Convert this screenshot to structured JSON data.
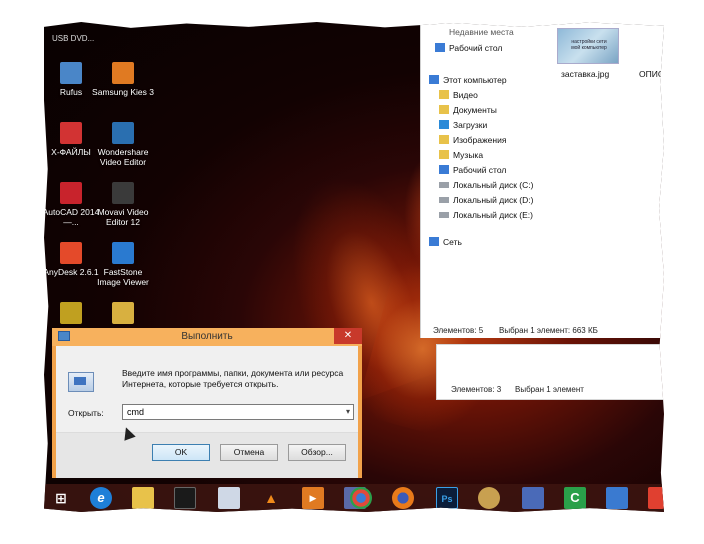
{
  "desktop": {
    "top_label": "USB DVD...",
    "icons": [
      {
        "label": "Rufus",
        "color": "#4a86c8"
      },
      {
        "label": "Samsung Kies 3",
        "color": "#e07a22"
      },
      {
        "label": "X-ФАЙЛЫ",
        "color": "#d23333"
      },
      {
        "label": "Wondershare Video Editor",
        "color": "#2a6fb0"
      },
      {
        "label": "AutoCAD 2014 —...",
        "color": "#c8232c"
      },
      {
        "label": "Movavi Video Editor 12",
        "color": "#3a3a3a"
      },
      {
        "label": "AnyDesk 2.6.1",
        "color": "#e44a2a"
      },
      {
        "label": "FastStone Image Viewer",
        "color": "#2a7ad0"
      },
      {
        "label": "",
        "color": "#c0a020"
      },
      {
        "label": "",
        "color": "#d8b040"
      }
    ]
  },
  "explorer": {
    "partial_top": "Недавние места",
    "thumbnail_caption_line1": "настройки сети",
    "thumbnail_caption_line2": "мой компьютер",
    "nav": [
      {
        "label": "Рабочий стол",
        "icon": "desktop-folder-icon",
        "color": "#3a7bd5"
      },
      {
        "label": "Этот компьютер",
        "icon": "computer-icon",
        "color": "#3a7bd5"
      },
      {
        "label": "Видео",
        "icon": "video-folder-icon",
        "color": "#e8c24a"
      },
      {
        "label": "Документы",
        "icon": "documents-folder-icon",
        "color": "#e8c24a"
      },
      {
        "label": "Загрузки",
        "icon": "downloads-folder-icon",
        "color": "#2a8ad8"
      },
      {
        "label": "Изображения",
        "icon": "pictures-folder-icon",
        "color": "#e8c24a"
      },
      {
        "label": "Музыка",
        "icon": "music-folder-icon",
        "color": "#e8c24a"
      },
      {
        "label": "Рабочий стол",
        "icon": "desktop-folder-icon",
        "color": "#3a7bd5"
      },
      {
        "label": "Локальный диск (C:)",
        "icon": "drive-icon",
        "color": "#9aa0a8"
      },
      {
        "label": "Локальный диск (D:)",
        "icon": "drive-icon",
        "color": "#9aa0a8"
      },
      {
        "label": "Локальный диск (E:)",
        "icon": "drive-icon",
        "color": "#9aa0a8"
      },
      {
        "label": "Сеть",
        "icon": "network-icon",
        "color": "#3a7bd5"
      }
    ],
    "file1": "заставка.jpg",
    "file2": "ОПИСА",
    "status_count": "Элементов: 5",
    "status_selected": "Выбран 1 элемент: 663 КБ"
  },
  "explorer2": {
    "status_count": "Элементов: 3",
    "status_selected": "Выбран 1 элемент"
  },
  "run_dialog": {
    "title": "Выполнить",
    "close": "✕",
    "description": "Введите имя программы, папки, документа или ресурса Интернета, которые требуется открыть.",
    "open_label": "Открыть:",
    "input_value": "cmd",
    "ok": "OK",
    "cancel": "Отмена",
    "browse": "Обзор..."
  },
  "taskbar": {
    "items": [
      {
        "name": "start-button",
        "glyph": "⊞",
        "color": "transparent"
      },
      {
        "name": "internet-explorer-icon",
        "glyph": "e",
        "color": "#1e7fd8"
      },
      {
        "name": "file-explorer-icon",
        "glyph": "",
        "color": "#e8c24a"
      },
      {
        "name": "cmd-icon",
        "glyph": "",
        "color": "#1a1a1a"
      },
      {
        "name": "notepad-icon",
        "glyph": "",
        "color": "#cfd8e6"
      },
      {
        "name": "vlc-icon",
        "glyph": "▲",
        "color": "transparent"
      },
      {
        "name": "media-player-icon",
        "glyph": "▶",
        "color": "#e07a22"
      },
      {
        "name": "firefox-like-icon",
        "glyph": "",
        "color": "#5a6aa8"
      },
      {
        "name": "chrome-icon",
        "glyph": "",
        "color": "#e04a3a"
      },
      {
        "name": "firefox-icon",
        "glyph": "",
        "color": "#e87a1a"
      },
      {
        "name": "photoshop-icon",
        "glyph": "Ps",
        "color": "#0b1d3a"
      },
      {
        "name": "paint-icon",
        "glyph": "",
        "color": "#c8a050"
      },
      {
        "name": "settings-app-icon",
        "glyph": "",
        "color": "#4a6ab8"
      },
      {
        "name": "camtasia-icon",
        "glyph": "C",
        "color": "#2aa04a"
      },
      {
        "name": "control-panel-icon",
        "glyph": "",
        "color": "#3a7ad0"
      },
      {
        "name": "app-icon",
        "glyph": "",
        "color": "#e04030"
      }
    ]
  }
}
